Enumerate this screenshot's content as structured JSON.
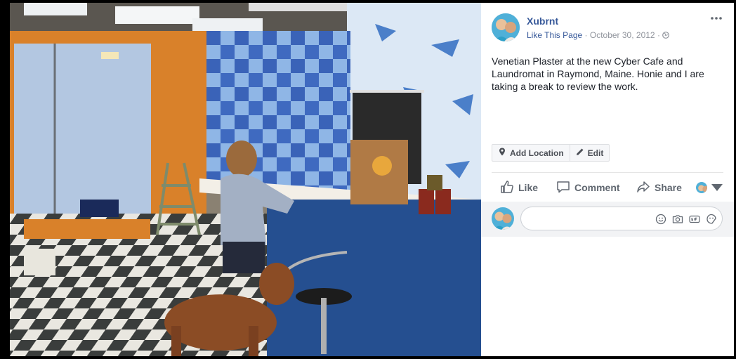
{
  "post": {
    "author": "Xubrnt",
    "like_page": "Like This Page",
    "separator": "·",
    "date": "October 30, 2012",
    "caption": "Venetian Plaster at the new Cyber Cafe and Laundromat in Raymond, Maine. Honie and I are taking a break to review the work."
  },
  "tag_bar": {
    "add_location": "Add Location",
    "edit": "Edit"
  },
  "actions": {
    "like": "Like",
    "comment": "Comment",
    "share": "Share"
  },
  "comment_box": {
    "placeholder": ""
  },
  "icons": {
    "more": "more-options-icon",
    "privacy": "globe-icon",
    "location": "map-pin-icon",
    "edit": "pencil-icon",
    "like": "thumbs-up-icon",
    "comment": "speech-bubble-icon",
    "share": "share-arrow-icon",
    "emoji": "smiley-icon",
    "camera": "camera-icon",
    "gif": "gif-icon",
    "sticker": "sticker-icon"
  },
  "colors": {
    "link": "#365899",
    "meta": "#90949c",
    "text": "#1d2129",
    "action": "#606770"
  }
}
